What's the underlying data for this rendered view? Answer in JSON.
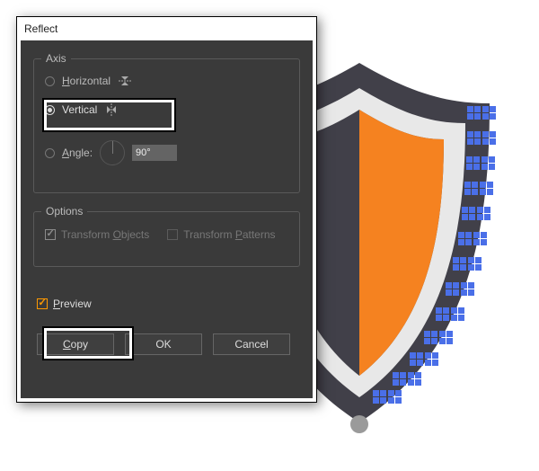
{
  "dialog": {
    "title": "Reflect",
    "axis": {
      "legend": "Axis",
      "horizontal": "Horizontal",
      "vertical": "Vertical",
      "angle_label": "Angle:",
      "angle_value": "90°",
      "selected": "vertical"
    },
    "options": {
      "legend": "Options",
      "transform_objects": "Transform Objects",
      "transform_patterns": "Transform Patterns",
      "objects_checked": true,
      "patterns_checked": false
    },
    "preview": {
      "label": "Preview",
      "checked": true
    },
    "buttons": {
      "copy": "Copy",
      "ok": "OK",
      "cancel": "Cancel"
    }
  },
  "shield": {
    "outer": "#414049",
    "mid": "#e8e8e8",
    "inner_left": "#414049",
    "inner_right": "#f58220",
    "marker": "#4a6fe8"
  }
}
